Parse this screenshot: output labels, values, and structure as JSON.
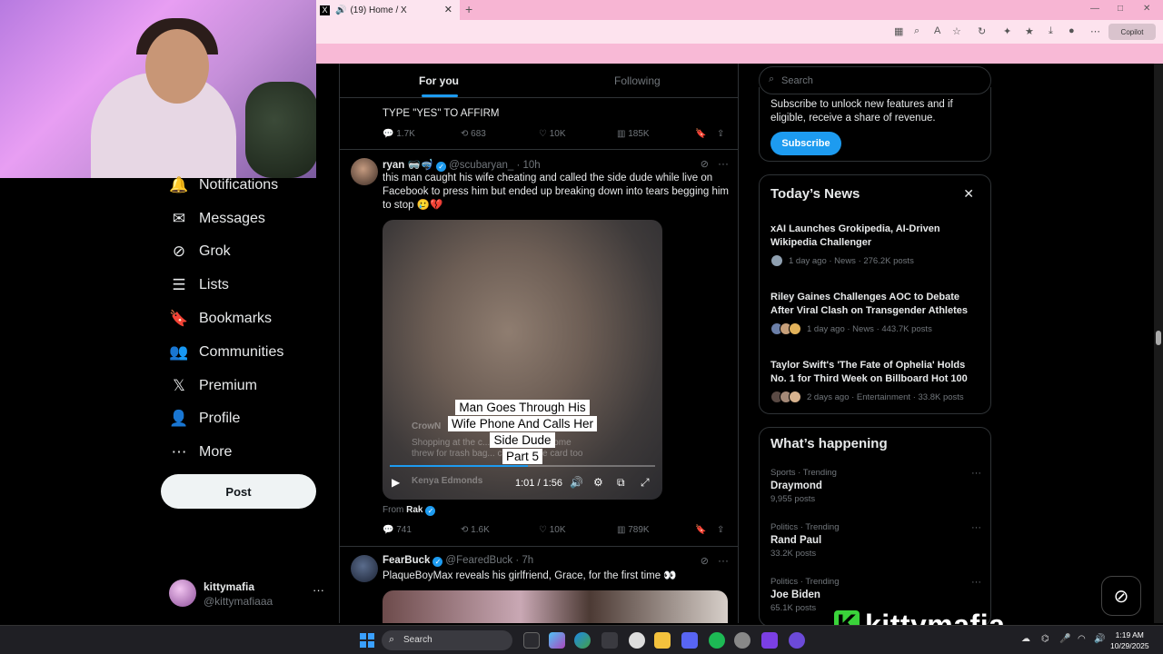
{
  "browser": {
    "tab_title": "(19) Home / X",
    "copilot_label": "Copilot"
  },
  "nav": {
    "items": [
      {
        "label": "Notifications",
        "icon": "bell-icon"
      },
      {
        "label": "Messages",
        "icon": "envelope-icon"
      },
      {
        "label": "Grok",
        "icon": "grok-icon"
      },
      {
        "label": "Lists",
        "icon": "list-icon"
      },
      {
        "label": "Bookmarks",
        "icon": "bookmark-icon"
      },
      {
        "label": "Communities",
        "icon": "people-icon"
      },
      {
        "label": "Premium",
        "icon": "x-logo-icon"
      },
      {
        "label": "Profile",
        "icon": "person-icon"
      },
      {
        "label": "More",
        "icon": "more-circle-icon"
      }
    ],
    "post_label": "Post",
    "user": {
      "name": "kittymafia",
      "handle": "@kittymafiaaa"
    }
  },
  "feed": {
    "tabs": [
      "For you",
      "Following"
    ],
    "active_tab": "For you",
    "prev_tweet": {
      "text": "TYPE \"YES\" TO AFFIRM",
      "replies": "1.7K",
      "reposts": "683",
      "likes": "10K",
      "views": "185K"
    },
    "tweet1": {
      "name": "ryan 🥽🤿",
      "handle": "@scubaryan_",
      "time": "· 10h",
      "text": "this man caught his wife cheating and called the side dude while live on Facebook to press him but ended up breaking down into tears begging him to stop 🥲💔",
      "video": {
        "caption_lines": [
          "Man Goes Through His",
          "Wife Phone And Calls Her",
          "Side Dude",
          "Part 5"
        ],
        "time": "1:01 / 1:56",
        "progress": 0.52,
        "bg_text_1": "CrowN",
        "bg_text_2": "Kenya Edmonds",
        "bg_text_3": "Shopping at the c... next time she come",
        "bg_text_4": "threw for trash bag... can a phone card too"
      },
      "from_label": "From",
      "from_name": "Rak",
      "replies": "741",
      "reposts": "1.6K",
      "likes": "10K",
      "views": "789K"
    },
    "tweet2": {
      "name": "FearBuck",
      "handle": "@FearedBuck",
      "time": "· 7h",
      "text": "PlaqueBoyMax reveals his girlfriend, Grace, for the first time 👀"
    }
  },
  "sidebar": {
    "search_placeholder": "Search",
    "premium_text": "Subscribe to unlock new features and if eligible, receive a share of revenue.",
    "subscribe_label": "Subscribe",
    "news_title": "Today’s News",
    "news": [
      {
        "title": "xAI Launches Grokipedia, AI-Driven Wikipedia Challenger",
        "meta": "1 day ago · News · 276.2K posts"
      },
      {
        "title": "Riley Gaines Challenges AOC to Debate After Viral Clash on Transgender Athletes",
        "meta": "1 day ago · News · 443.7K posts"
      },
      {
        "title": "Taylor Swift's 'The Fate of Ophelia' Holds No. 1 for Third Week on Billboard Hot 100",
        "meta": "2 days ago · Entertainment · 33.8K posts"
      }
    ],
    "happening_title": "What’s happening",
    "trends": [
      {
        "category": "Sports · Trending",
        "name": "Draymond",
        "posts": "9,955 posts"
      },
      {
        "category": "Politics · Trending",
        "name": "Rand Paul",
        "posts": "33.2K posts"
      },
      {
        "category": "Politics · Trending",
        "name": "Joe Biden",
        "posts": "65.1K posts"
      }
    ]
  },
  "overlay": {
    "watermark": "kittymafia"
  },
  "taskbar": {
    "search_label": "Search",
    "time": "1:19 AM",
    "date": "10/29/2025"
  },
  "colors": {
    "accent": "#1d9bf0",
    "brand_green": "#3ad33a",
    "browser_pink": "#f7b5d3"
  }
}
